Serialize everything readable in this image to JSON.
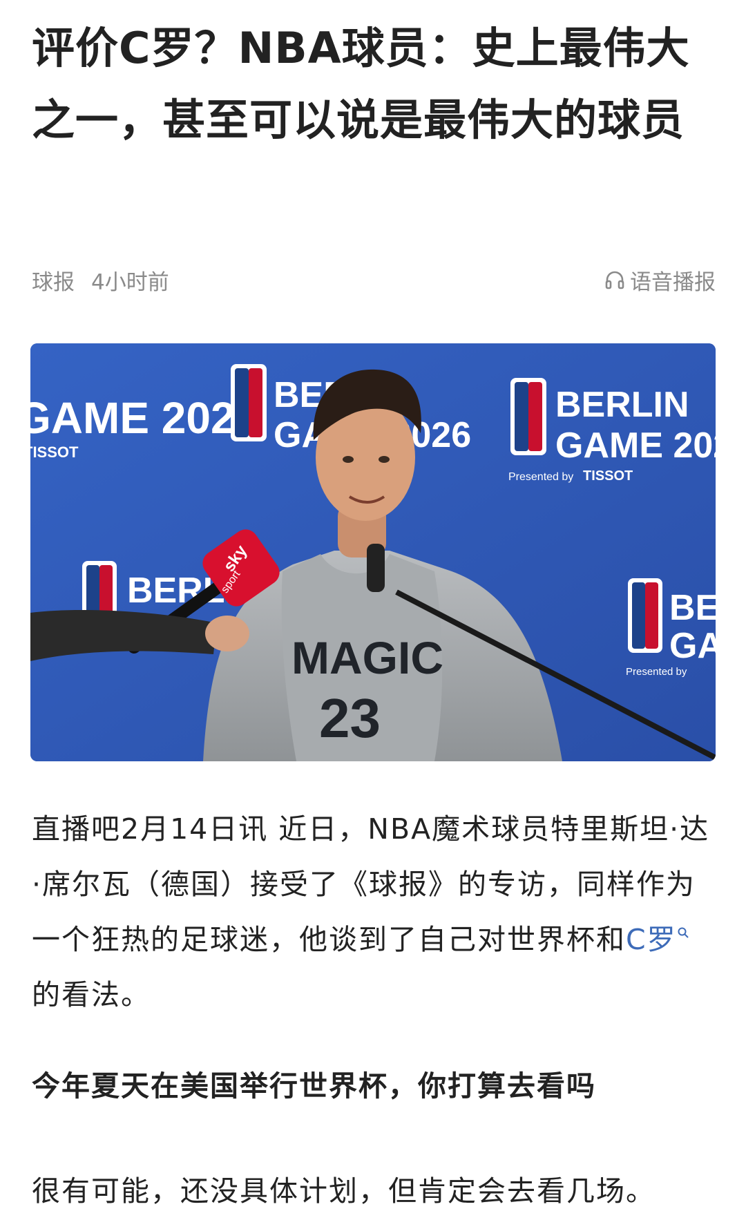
{
  "article": {
    "title": "评价C罗？NBA球员：史上最伟大之一，甚至可以说是最伟大的球员",
    "source": "球报",
    "time": "4小时前",
    "listen_label": "语音播报"
  },
  "photo": {
    "backdrop_brand_top": "BERLIN",
    "backdrop_brand_bottom": "GAME 2026",
    "backdrop_presented": "Presented by",
    "backdrop_sponsor": "TISSOT",
    "nba_logo_text": "NBA",
    "jersey_team": "MAGIC",
    "jersey_number": "23",
    "mic_brand": "sky",
    "mic_sub": "sport"
  },
  "content": {
    "p1_before": "直播吧2月14日讯 近日，NBA魔术球员特里斯坦·达·席尔瓦（德国）接受了《球报》的专访，同样作为一个狂热的足球迷，他谈到了自己对世界杯和",
    "p1_link": "C罗",
    "p1_after": " 的看法。",
    "p2": "今年夏天在美国举行世界杯，你打算去看吗",
    "p3": "很有可能，还没具体计划，但肯定会去看几场。"
  },
  "colors": {
    "link": "#3d6bb8",
    "meta_gray": "#8a8a8a",
    "backdrop_blue": "#2b55b5"
  }
}
